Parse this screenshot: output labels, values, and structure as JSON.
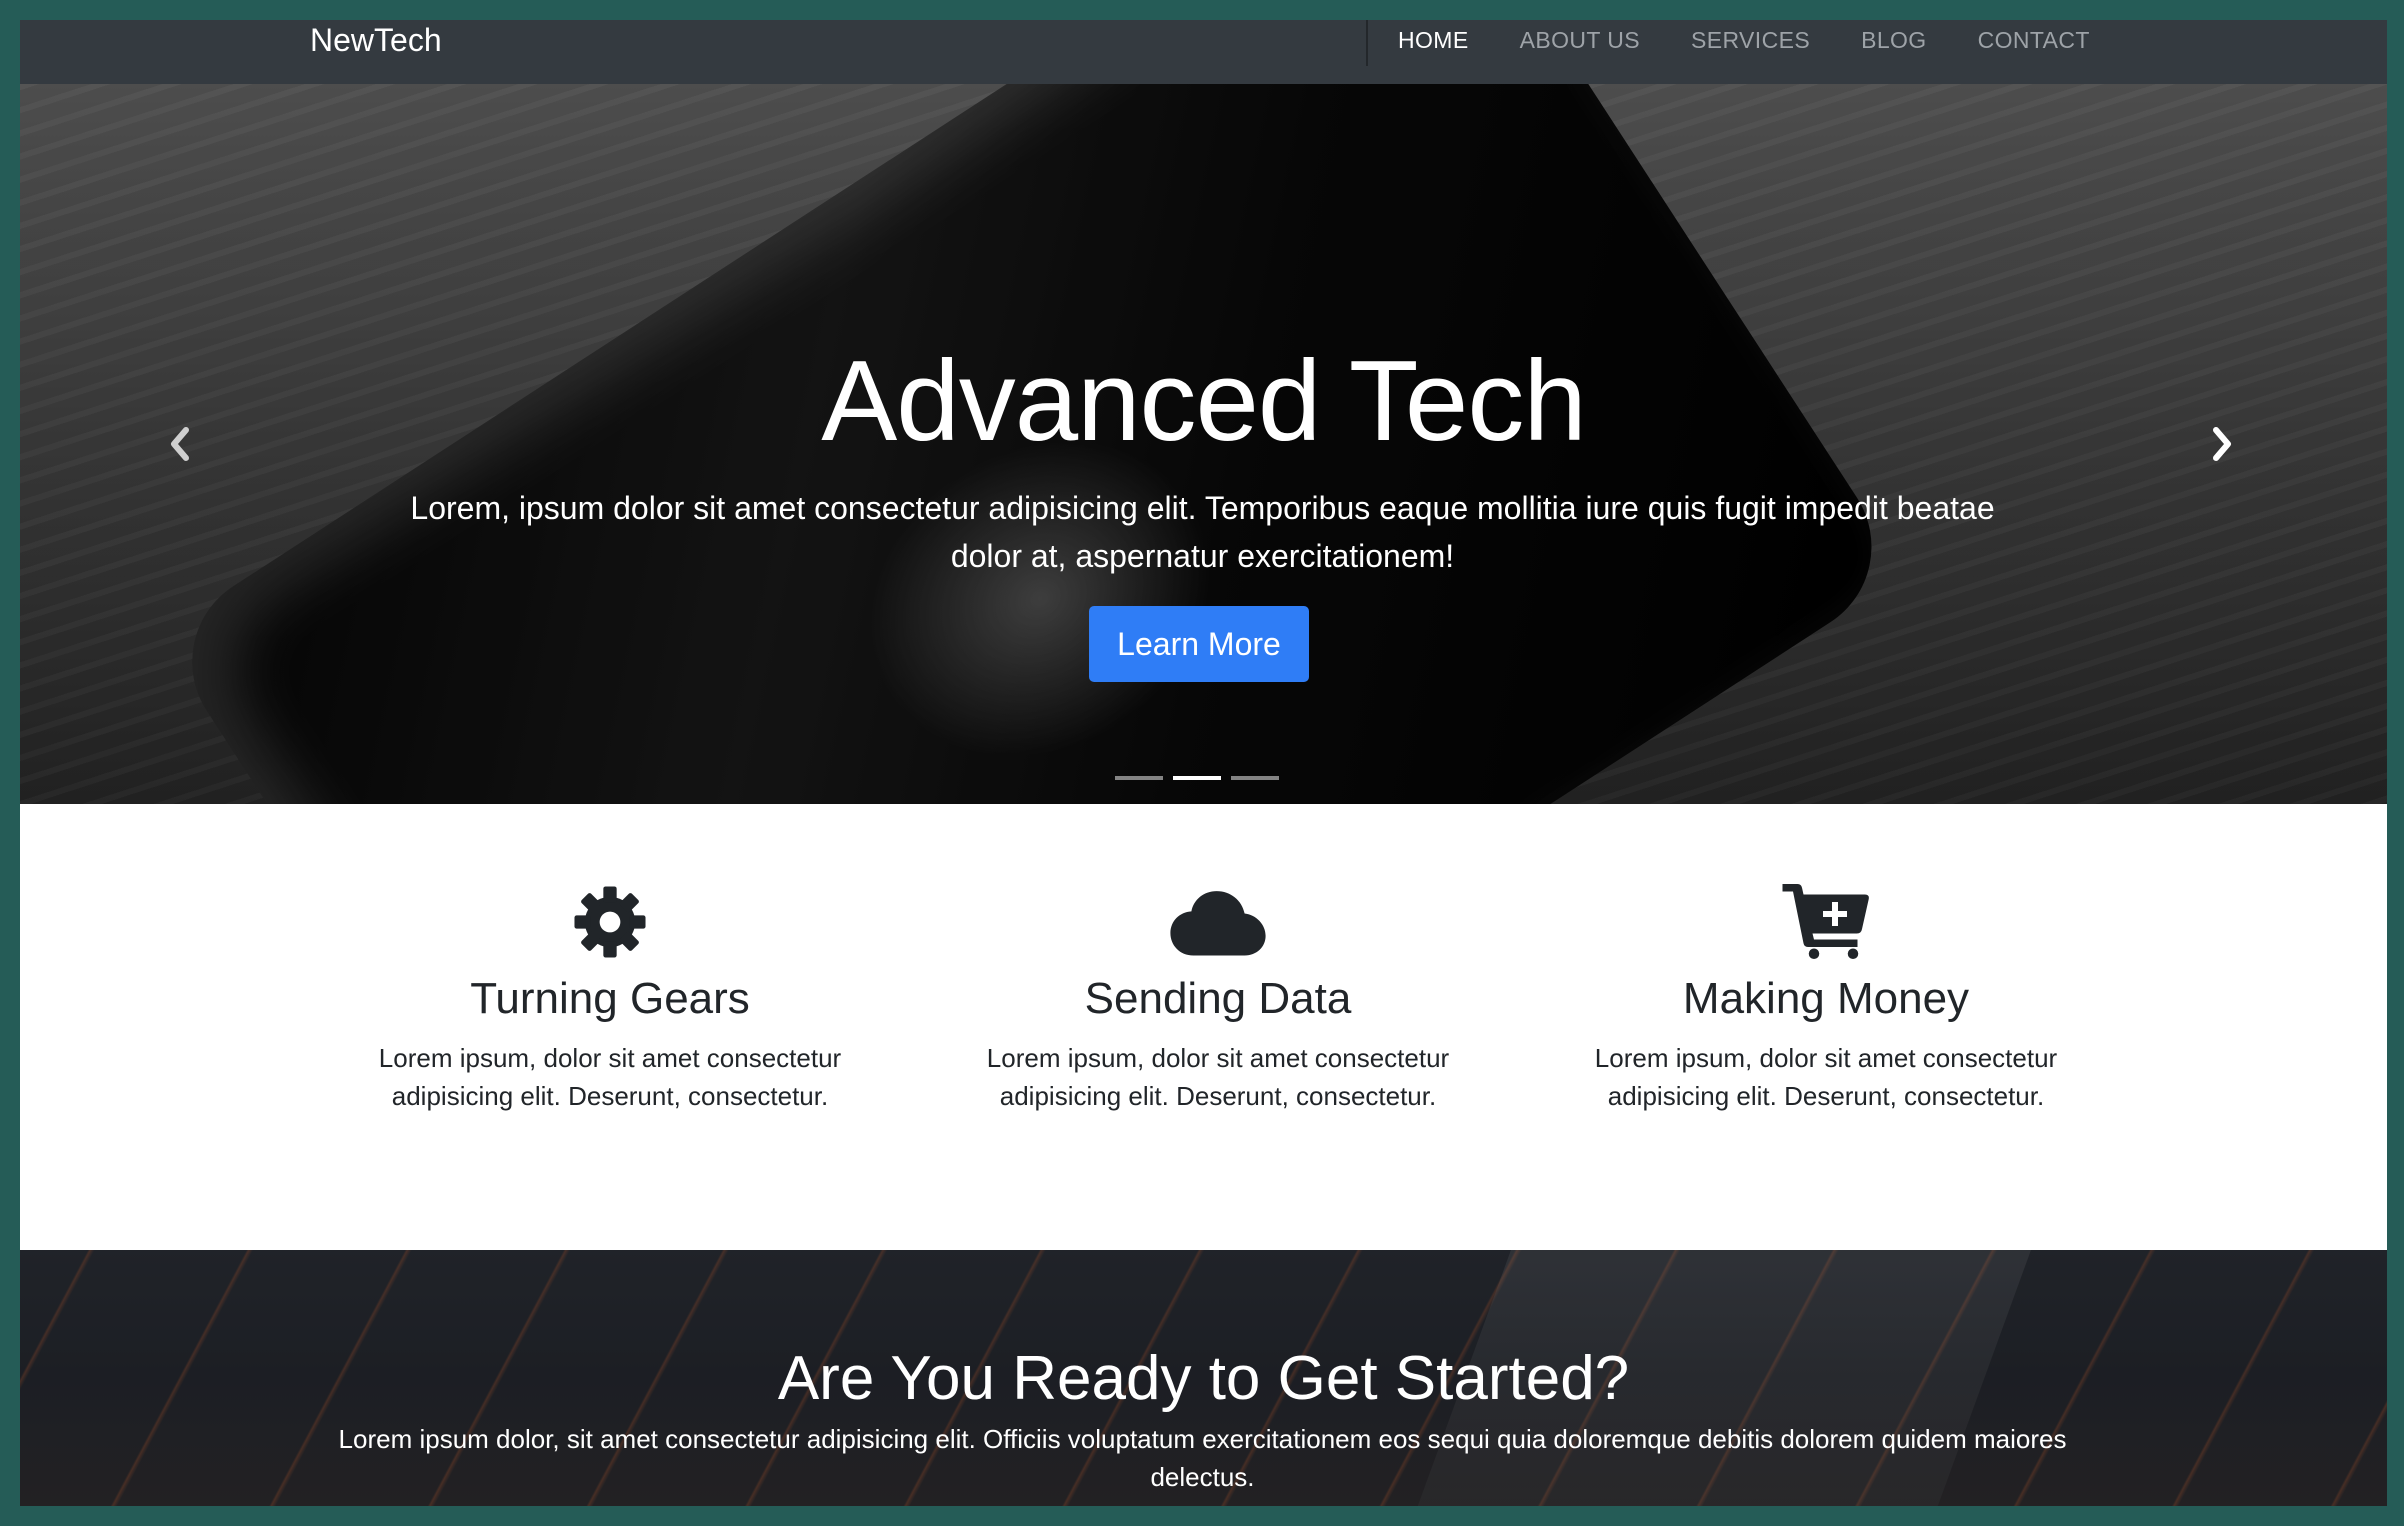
{
  "navbar": {
    "brand": "NewTech",
    "links": [
      {
        "label": "HOME",
        "active": true
      },
      {
        "label": "ABOUT US",
        "active": false
      },
      {
        "label": "SERVICES",
        "active": false
      },
      {
        "label": "BLOG",
        "active": false
      },
      {
        "label": "CONTACT",
        "active": false
      }
    ]
  },
  "hero": {
    "title": "Advanced Tech",
    "text": "Lorem, ipsum dolor sit amet consectetur adipisicing elit. Temporibus eaque mollitia iure quis fugit impedit beatae dolor at, aspernatur exercitationem!",
    "button_label": "Learn More",
    "prev_icon": "chevron-left-icon",
    "next_icon": "chevron-right-icon",
    "slide_count": 3,
    "active_slide": 2
  },
  "features": [
    {
      "icon": "gear-icon",
      "title": "Turning Gears",
      "text": "Lorem ipsum, dolor sit amet consectetur adipisicing elit. Deserunt, consectetur."
    },
    {
      "icon": "cloud-icon",
      "title": "Sending Data",
      "text": "Lorem ipsum, dolor sit amet consectetur adipisicing elit. Deserunt, consectetur."
    },
    {
      "icon": "cart-plus-icon",
      "title": "Making Money",
      "text": "Lorem ipsum, dolor sit amet consectetur adipisicing elit. Deserunt, consectetur."
    }
  ],
  "cta": {
    "title": "Are You Ready to Get Started?",
    "text": "Lorem ipsum dolor, sit amet consectetur adipisicing elit. Officiis voluptatum exercitationem eos sequi quia doloremque debitis dolorem quidem maiores delectus."
  },
  "colors": {
    "frame": "#255c57",
    "navbar": "#343a40",
    "primary_button": "#2f7df6",
    "text_dark": "#212529"
  }
}
